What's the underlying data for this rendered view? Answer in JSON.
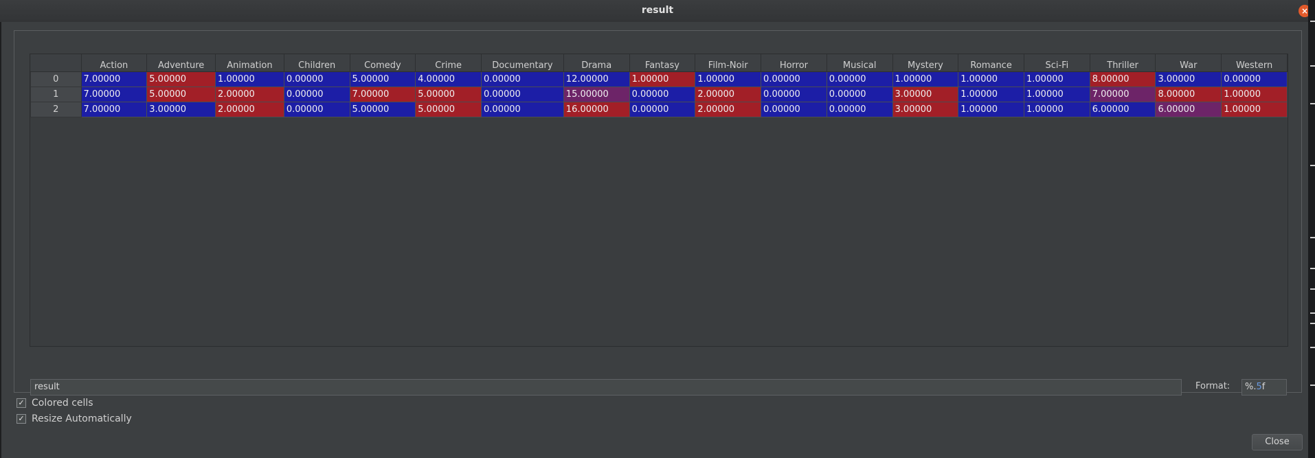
{
  "window": {
    "title": "result"
  },
  "colors": {
    "blue": "#1c1ea6",
    "red": "#a21f27",
    "purple": "#6d2468"
  },
  "table": {
    "columns": [
      "Action",
      "Adventure",
      "Animation",
      "Children",
      "Comedy",
      "Crime",
      "Documentary",
      "Drama",
      "Fantasy",
      "Film-Noir",
      "Horror",
      "Musical",
      "Mystery",
      "Romance",
      "Sci-Fi",
      "Thriller",
      "War",
      "Western"
    ],
    "rows": [
      {
        "index": "0",
        "cells": [
          "7.00000",
          "5.00000",
          "1.00000",
          "0.00000",
          "5.00000",
          "4.00000",
          "0.00000",
          "12.00000",
          "1.00000",
          "1.00000",
          "0.00000",
          "0.00000",
          "1.00000",
          "1.00000",
          "1.00000",
          "8.00000",
          "3.00000",
          "0.00000"
        ]
      },
      {
        "index": "1",
        "cells": [
          "7.00000",
          "5.00000",
          "2.00000",
          "0.00000",
          "7.00000",
          "5.00000",
          "0.00000",
          "15.00000",
          "0.00000",
          "2.00000",
          "0.00000",
          "0.00000",
          "3.00000",
          "1.00000",
          "1.00000",
          "7.00000",
          "8.00000",
          "1.00000"
        ]
      },
      {
        "index": "2",
        "cells": [
          "7.00000",
          "3.00000",
          "2.00000",
          "0.00000",
          "5.00000",
          "5.00000",
          "0.00000",
          "16.00000",
          "0.00000",
          "2.00000",
          "0.00000",
          "0.00000",
          "3.00000",
          "1.00000",
          "1.00000",
          "6.00000",
          "6.00000",
          "1.00000"
        ]
      }
    ],
    "cell_colors": [
      [
        "blue",
        "red",
        "blue",
        "blue",
        "blue",
        "blue",
        "blue",
        "blue",
        "red",
        "blue",
        "blue",
        "blue",
        "blue",
        "blue",
        "blue",
        "red",
        "blue",
        "blue"
      ],
      [
        "blue",
        "red",
        "red",
        "blue",
        "red",
        "red",
        "blue",
        "purple",
        "blue",
        "red",
        "blue",
        "blue",
        "red",
        "blue",
        "blue",
        "purple",
        "red",
        "red"
      ],
      [
        "blue",
        "blue",
        "red",
        "blue",
        "blue",
        "red",
        "blue",
        "red",
        "blue",
        "red",
        "blue",
        "blue",
        "red",
        "blue",
        "blue",
        "blue",
        "purple",
        "red"
      ]
    ]
  },
  "footer": {
    "name_value": "result",
    "format_label": "Format:",
    "format_prefix": "%.",
    "format_number": "5",
    "format_suffix": "f",
    "colored_cells_label": "Colored cells",
    "colored_cells_checked": true,
    "resize_label": "Resize Automatically",
    "resize_checked": true,
    "close_label": "Close"
  }
}
